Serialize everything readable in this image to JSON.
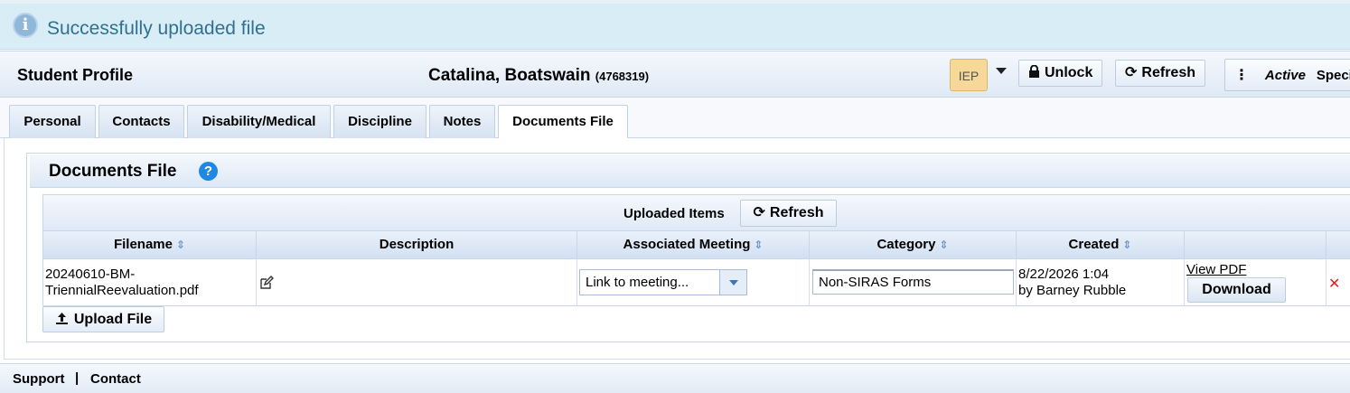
{
  "alert": {
    "message": "Successfully uploaded file"
  },
  "header": {
    "title": "Student Profile",
    "student_name": "Catalina, Boatswain",
    "student_id": "(4768319)",
    "iep_label": "IEP",
    "unlock_label": "Unlock",
    "refresh_label": "Refresh",
    "status": "Active",
    "status_extra": "Specia"
  },
  "tabs": [
    {
      "label": "Personal"
    },
    {
      "label": "Contacts"
    },
    {
      "label": "Disability/Medical"
    },
    {
      "label": "Discipline"
    },
    {
      "label": "Notes"
    },
    {
      "label": "Documents File",
      "active": true
    }
  ],
  "documents": {
    "title": "Documents File",
    "uploaded_label": "Uploaded Items",
    "refresh_label": "Refresh",
    "columns": [
      "Filename",
      "Description",
      "Associated Meeting",
      "Category",
      "Created"
    ],
    "rows": [
      {
        "filename_line1": "20240610-BM-",
        "filename_line2": "TriennialReevaluation.pdf",
        "meeting": "Link to meeting...",
        "category": "Non-SIRAS Forms",
        "created_date": "8/22/2026 1:04",
        "created_by": "by Barney Rubble",
        "view_pdf": "View PDF",
        "download": "Download",
        "delete": "✕"
      }
    ],
    "upload_label": "Upload File"
  },
  "footer": {
    "support": "Support",
    "separator": "|",
    "contact": "Contact"
  },
  "colors": {
    "alert_bg": "#d9edf7",
    "alert_text": "#31708f",
    "help_blue": "#1f88e5",
    "delete_red": "#e0201e",
    "iep_folder": "#f6d898"
  }
}
